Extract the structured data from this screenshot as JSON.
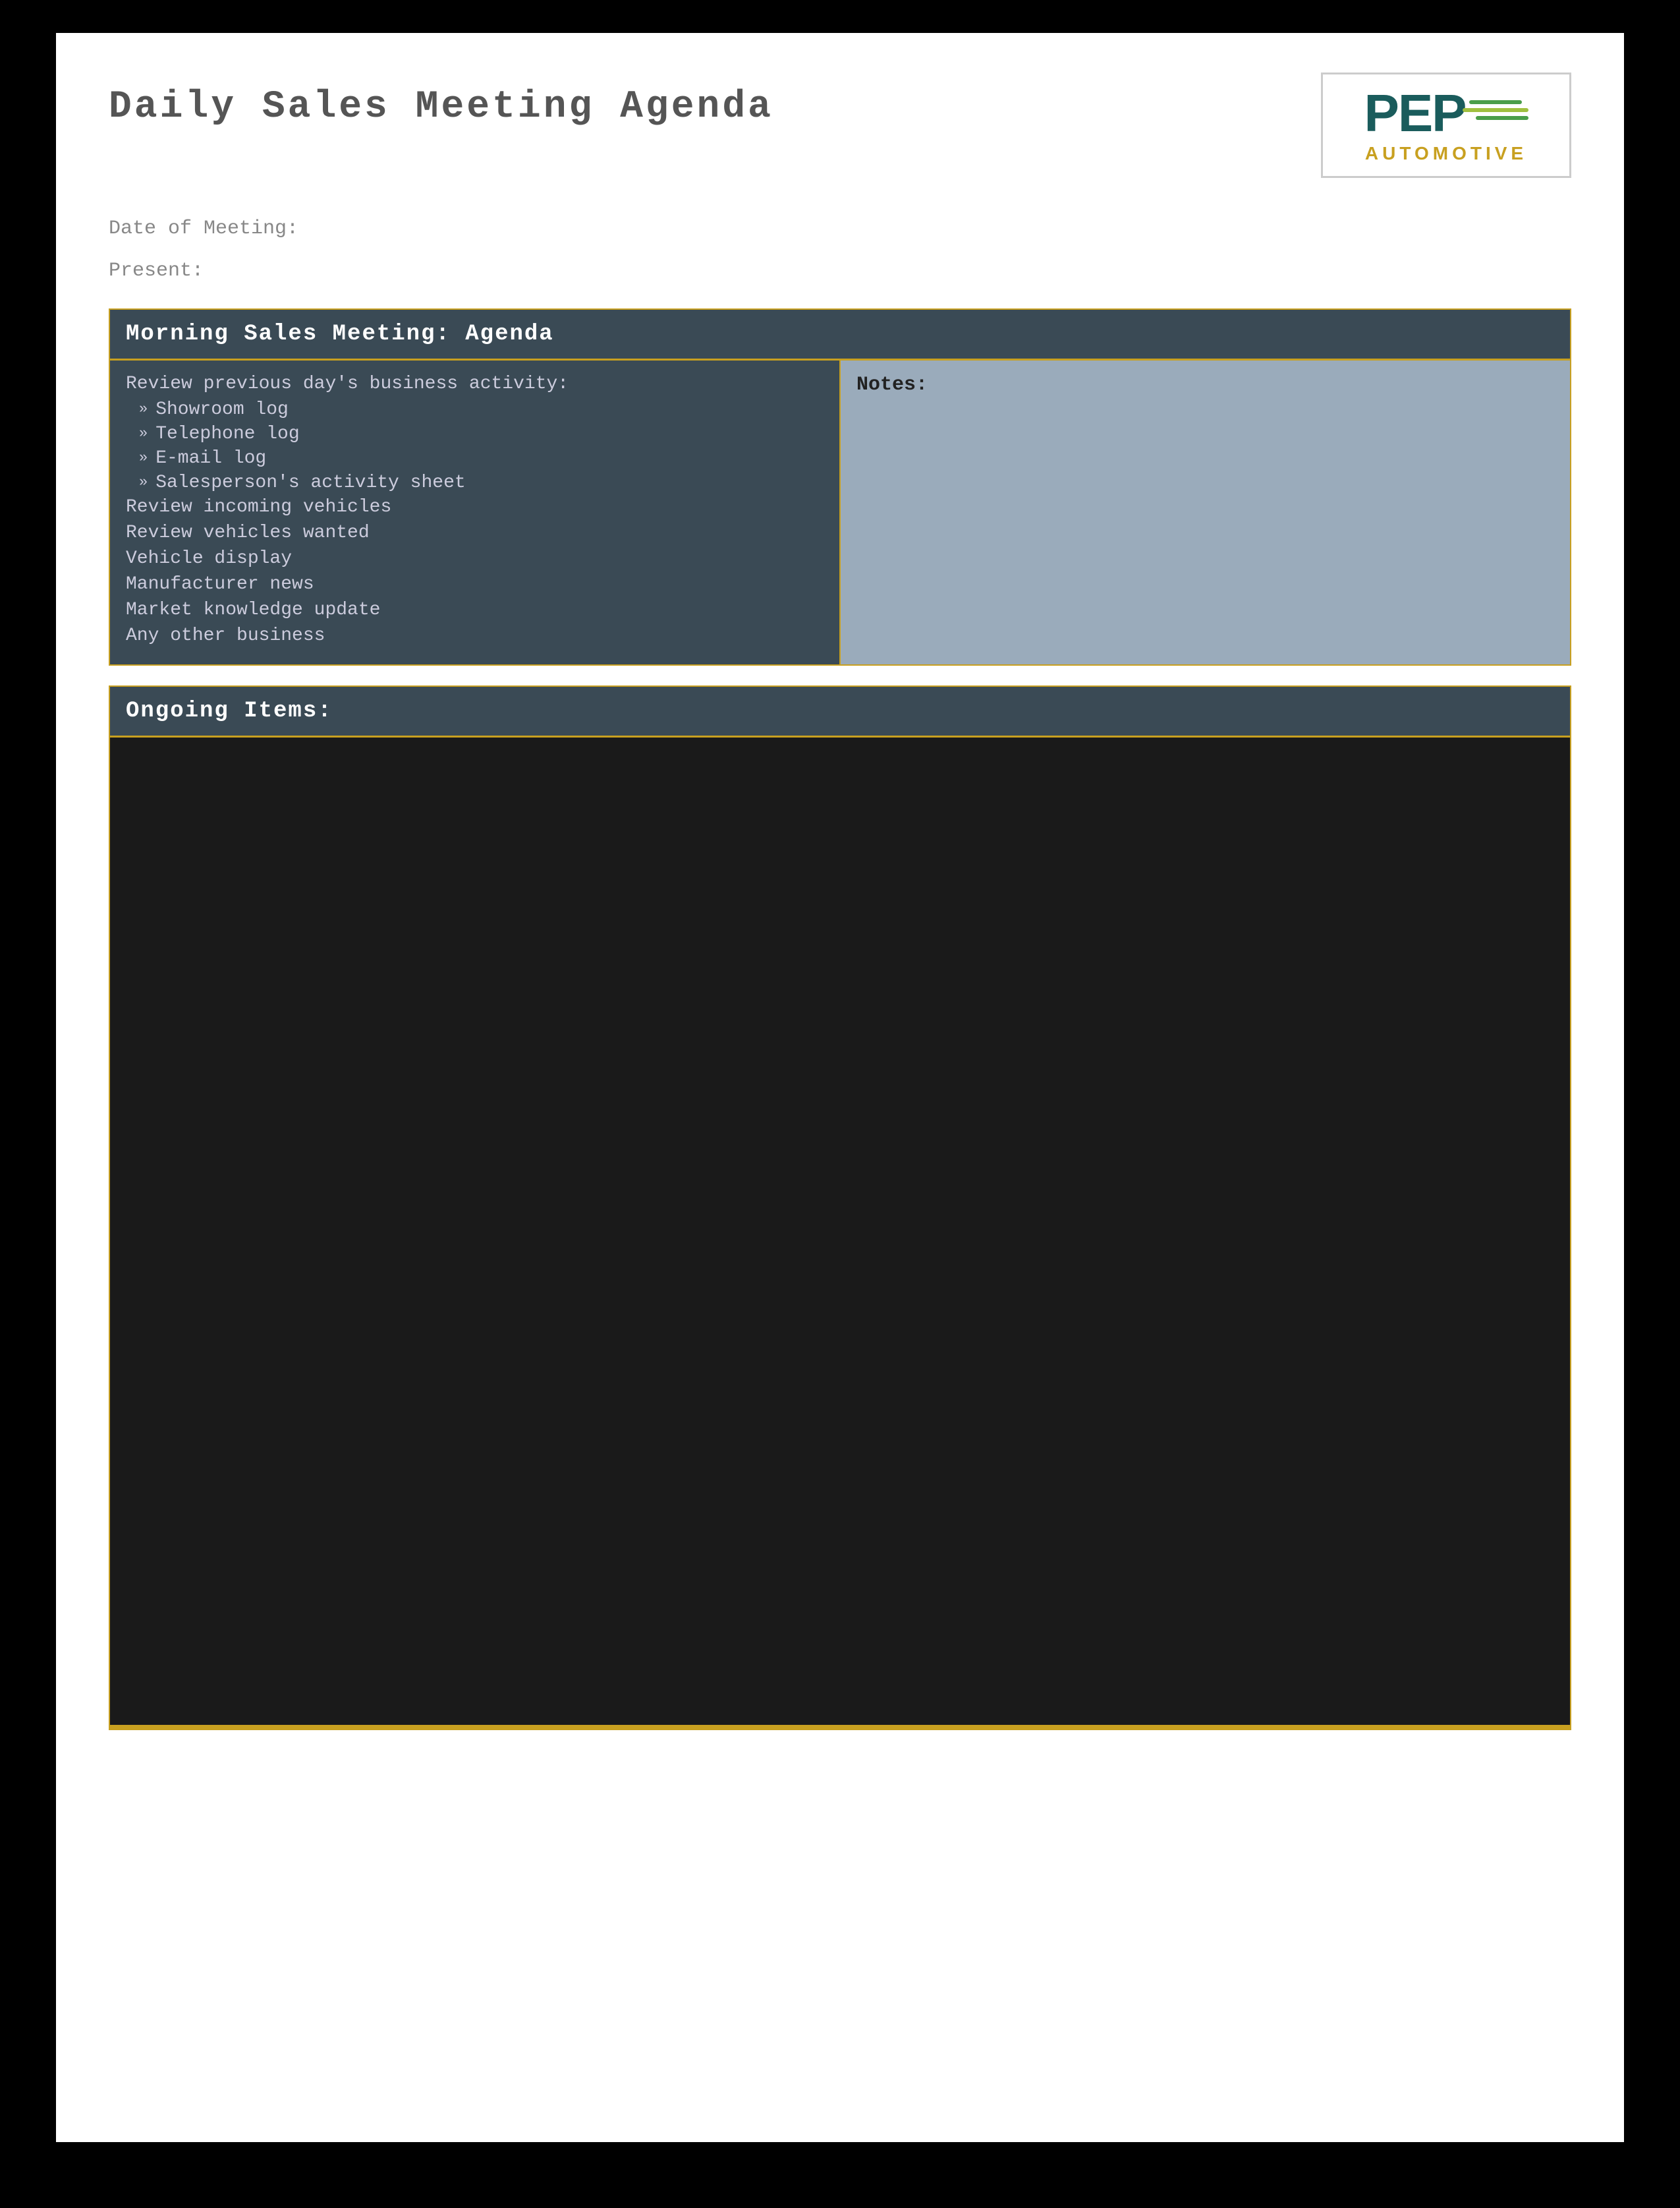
{
  "page": {
    "title": "Daily Sales Meeting Agenda",
    "background": "#000"
  },
  "header": {
    "title": "Daily Sales Meeting Agenda",
    "logo": {
      "name": "PEP",
      "tagline": "AUTOMOTIVE"
    }
  },
  "meta": {
    "date_label": "Date of Meeting:",
    "present_label": "Present:"
  },
  "morning_section": {
    "header": "Morning Sales Meeting: Agenda",
    "agenda_items": {
      "review_label": "Review previous day's business activity:",
      "sub_items": [
        "Showroom log",
        "Telephone log",
        "E-mail log",
        "Salesperson's activity sheet"
      ],
      "main_items": [
        "Review incoming vehicles",
        "Review vehicles wanted",
        "Vehicle display",
        "Manufacturer news",
        "Market knowledge update",
        "Any other business"
      ]
    },
    "notes_label": "Notes:"
  },
  "ongoing_section": {
    "header": "Ongoing Items:"
  },
  "colors": {
    "gold": "#c8a020",
    "dark_slate": "#3a4a55",
    "notes_bg": "#9aabbb",
    "text_light": "#ccd",
    "ongoing_bg": "#1a1a1a"
  }
}
